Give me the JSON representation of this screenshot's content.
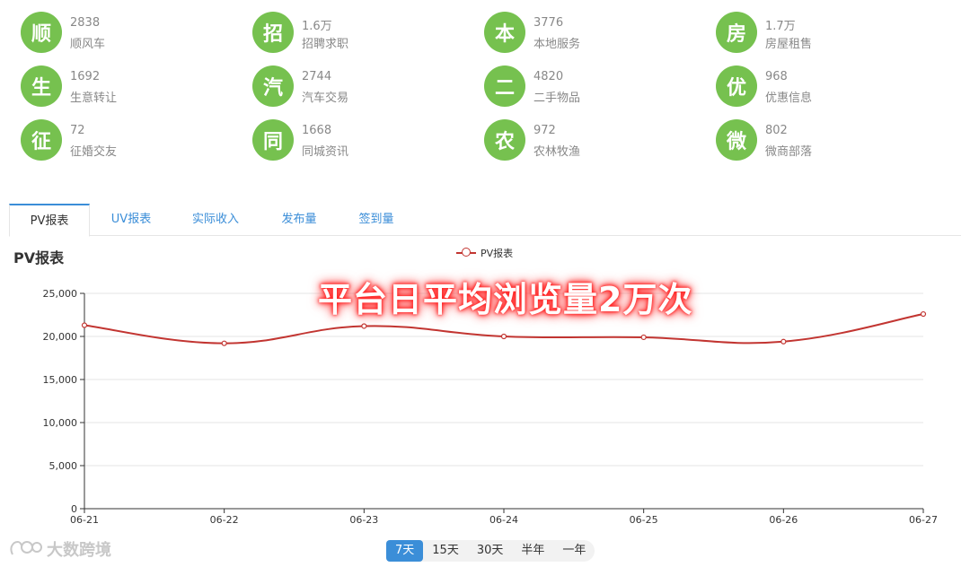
{
  "stats": [
    {
      "icon": "顺",
      "value": "2838",
      "label": "顺风车"
    },
    {
      "icon": "招",
      "value": "1.6万",
      "label": "招聘求职"
    },
    {
      "icon": "本",
      "value": "3776",
      "label": "本地服务"
    },
    {
      "icon": "房",
      "value": "1.7万",
      "label": "房屋租售"
    },
    {
      "icon": "生",
      "value": "1692",
      "label": "生意转让"
    },
    {
      "icon": "汽",
      "value": "2744",
      "label": "汽车交易"
    },
    {
      "icon": "二",
      "value": "4820",
      "label": "二手物品"
    },
    {
      "icon": "优",
      "value": "968",
      "label": "优惠信息"
    },
    {
      "icon": "征",
      "value": "72",
      "label": "征婚交友"
    },
    {
      "icon": "同",
      "value": "1668",
      "label": "同城资讯"
    },
    {
      "icon": "农",
      "value": "972",
      "label": "农林牧渔"
    },
    {
      "icon": "微",
      "value": "802",
      "label": "微商部落"
    }
  ],
  "tabs": [
    "PV报表",
    "UV报表",
    "实际收入",
    "发布量",
    "签到量"
  ],
  "chart_title": "PV报表",
  "overlay": "平台日平均浏览量2万次",
  "range_buttons": [
    "7天",
    "15天",
    "30天",
    "半年",
    "一年"
  ],
  "watermark": "大数跨境",
  "colors": {
    "accent": "#3b8ed8",
    "badge": "#76c14f",
    "series": "#c23531"
  },
  "chart_data": {
    "type": "line",
    "title": "PV报表",
    "categories": [
      "06-21",
      "06-22",
      "06-23",
      "06-24",
      "06-25",
      "06-26",
      "06-27"
    ],
    "series": [
      {
        "name": "PV报表",
        "values": [
          21300,
          19200,
          21200,
          20000,
          19900,
          19400,
          22600
        ],
        "smooth": true
      }
    ],
    "ylim": [
      0,
      25000
    ],
    "yticks": [
      0,
      5000,
      10000,
      15000,
      20000,
      25000
    ],
    "ytick_labels": [
      "0",
      "5,000",
      "10,000",
      "15,000",
      "20,000",
      "25,000"
    ],
    "grid": true,
    "legend": "top-center"
  }
}
